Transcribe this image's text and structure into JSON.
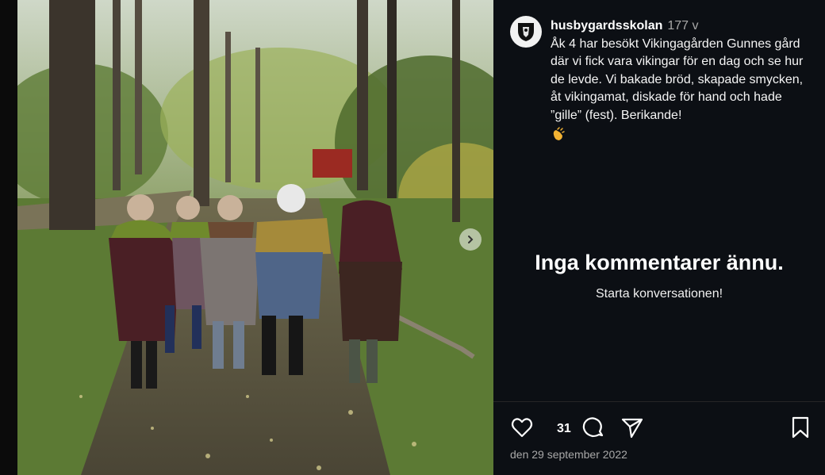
{
  "post": {
    "username": "husbygardsskolan",
    "time_ago": "177 v",
    "caption": "Åk 4 har besökt Vikingagården Gunnes gård där vi fick vara vikingar för en dag och se hur de levde. Vi bakade bröd, skapade smycken, åt vikingamat, diskade för hand och hade ”gille” (fest). Berikande!",
    "caption_emoji": "clapping-hands-emoji"
  },
  "comments": {
    "empty_title": "Inga kommentarer ännu.",
    "empty_subtitle": "Starta konversationen!"
  },
  "actions": {
    "like_count": "31",
    "icons": [
      "heart-icon",
      "comment-icon",
      "share-icon",
      "bookmark-icon"
    ]
  },
  "post_date": "den 29 september 2022",
  "media": {
    "nav_icon": "chevron-right-icon"
  },
  "colors": {
    "panel_bg": "#0c0f14",
    "page_bg": "#000000",
    "muted_text": "#a8a8a8"
  }
}
